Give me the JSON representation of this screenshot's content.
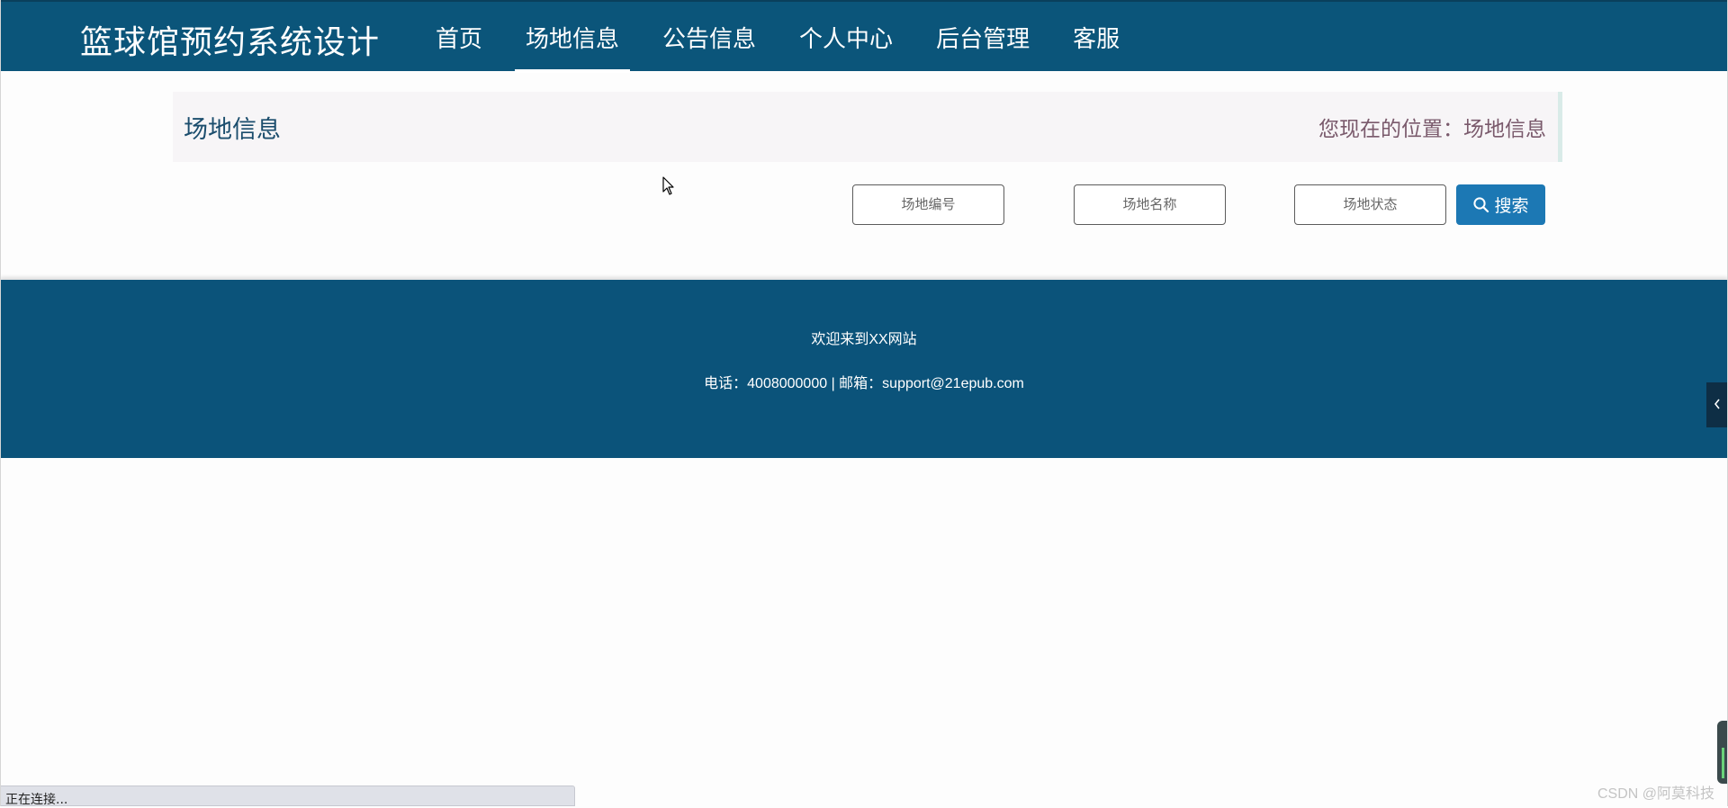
{
  "header": {
    "brand": "篮球馆预约系统设计",
    "nav": [
      {
        "label": "首页",
        "active": false
      },
      {
        "label": "场地信息",
        "active": true
      },
      {
        "label": "公告信息",
        "active": false
      },
      {
        "label": "个人中心",
        "active": false
      },
      {
        "label": "后台管理",
        "active": false
      },
      {
        "label": "客服",
        "active": false
      }
    ]
  },
  "breadcrumb": {
    "title": "场地信息",
    "location": "您现在的位置：场地信息"
  },
  "search": {
    "fields": [
      {
        "placeholder": "场地编号",
        "value": ""
      },
      {
        "placeholder": "场地名称",
        "value": ""
      },
      {
        "placeholder": "场地状态",
        "value": ""
      }
    ],
    "button_label": "搜索",
    "button_icon": "search-icon"
  },
  "footer": {
    "welcome": "欢迎来到XX网站",
    "contact": "电话：4008000000 | 邮箱：support@21epub.com"
  },
  "side_tab": {
    "icon": "chevron-left-icon"
  },
  "status_bar": {
    "text": "正在连接..."
  },
  "watermark": "CSDN @阿莫科技",
  "colors": {
    "header_bg": "#0b557a",
    "footer_bg": "#0b537a",
    "search_button": "#1c78b4",
    "breadcrumb_bg": "#f7f5f7"
  }
}
